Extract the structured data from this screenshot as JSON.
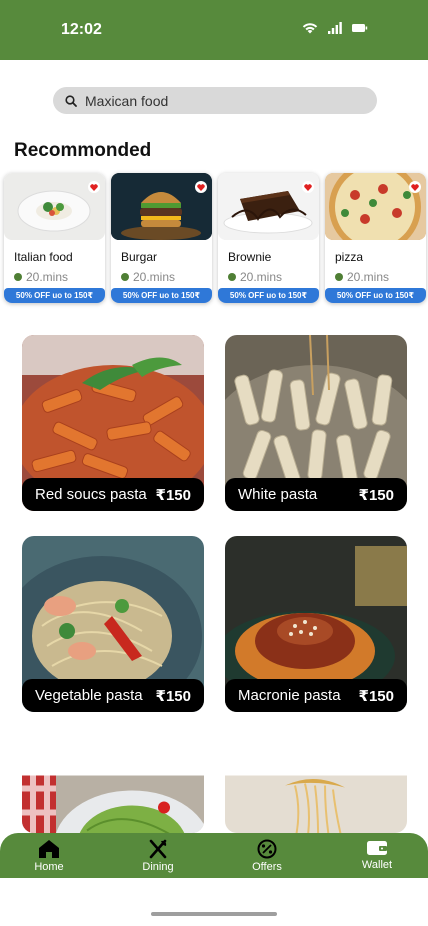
{
  "status_bar": {
    "time": "12:02",
    "icons": [
      "wifi-icon",
      "signal-icon",
      "battery-icon"
    ]
  },
  "search": {
    "placeholder": "Maxican food"
  },
  "section_title": "Recommonded",
  "recommended": [
    {
      "name": "Italian food",
      "time": "20.mins",
      "offer": "50% OFF uo to 150₹"
    },
    {
      "name": "Burgar",
      "time": "20.mins",
      "offer": "50% OFF uo to 150₹"
    },
    {
      "name": "Brownie",
      "time": "20.mins",
      "offer": "50% OFF uo to 150₹"
    },
    {
      "name": "pizza",
      "time": "20.mins",
      "offer": "50% OFF uo to 150₹"
    }
  ],
  "foods": [
    {
      "name": "Red soucs pasta",
      "price": "₹150"
    },
    {
      "name": "White  pasta",
      "price": "₹150"
    },
    {
      "name": "Vegetable pasta",
      "price": "₹150"
    },
    {
      "name": "Macronie pasta",
      "price": "₹150"
    }
  ],
  "bottom_nav": [
    {
      "label": "Home",
      "icon": "home-icon"
    },
    {
      "label": "Dining",
      "icon": "dining-icon"
    },
    {
      "label": "Offers",
      "icon": "offers-icon"
    },
    {
      "label": "Wallet",
      "icon": "wallet-icon"
    }
  ],
  "colors": {
    "brand_green": "#578a3c",
    "offer_blue": "#2f78d8",
    "heart_red": "#e02020"
  }
}
